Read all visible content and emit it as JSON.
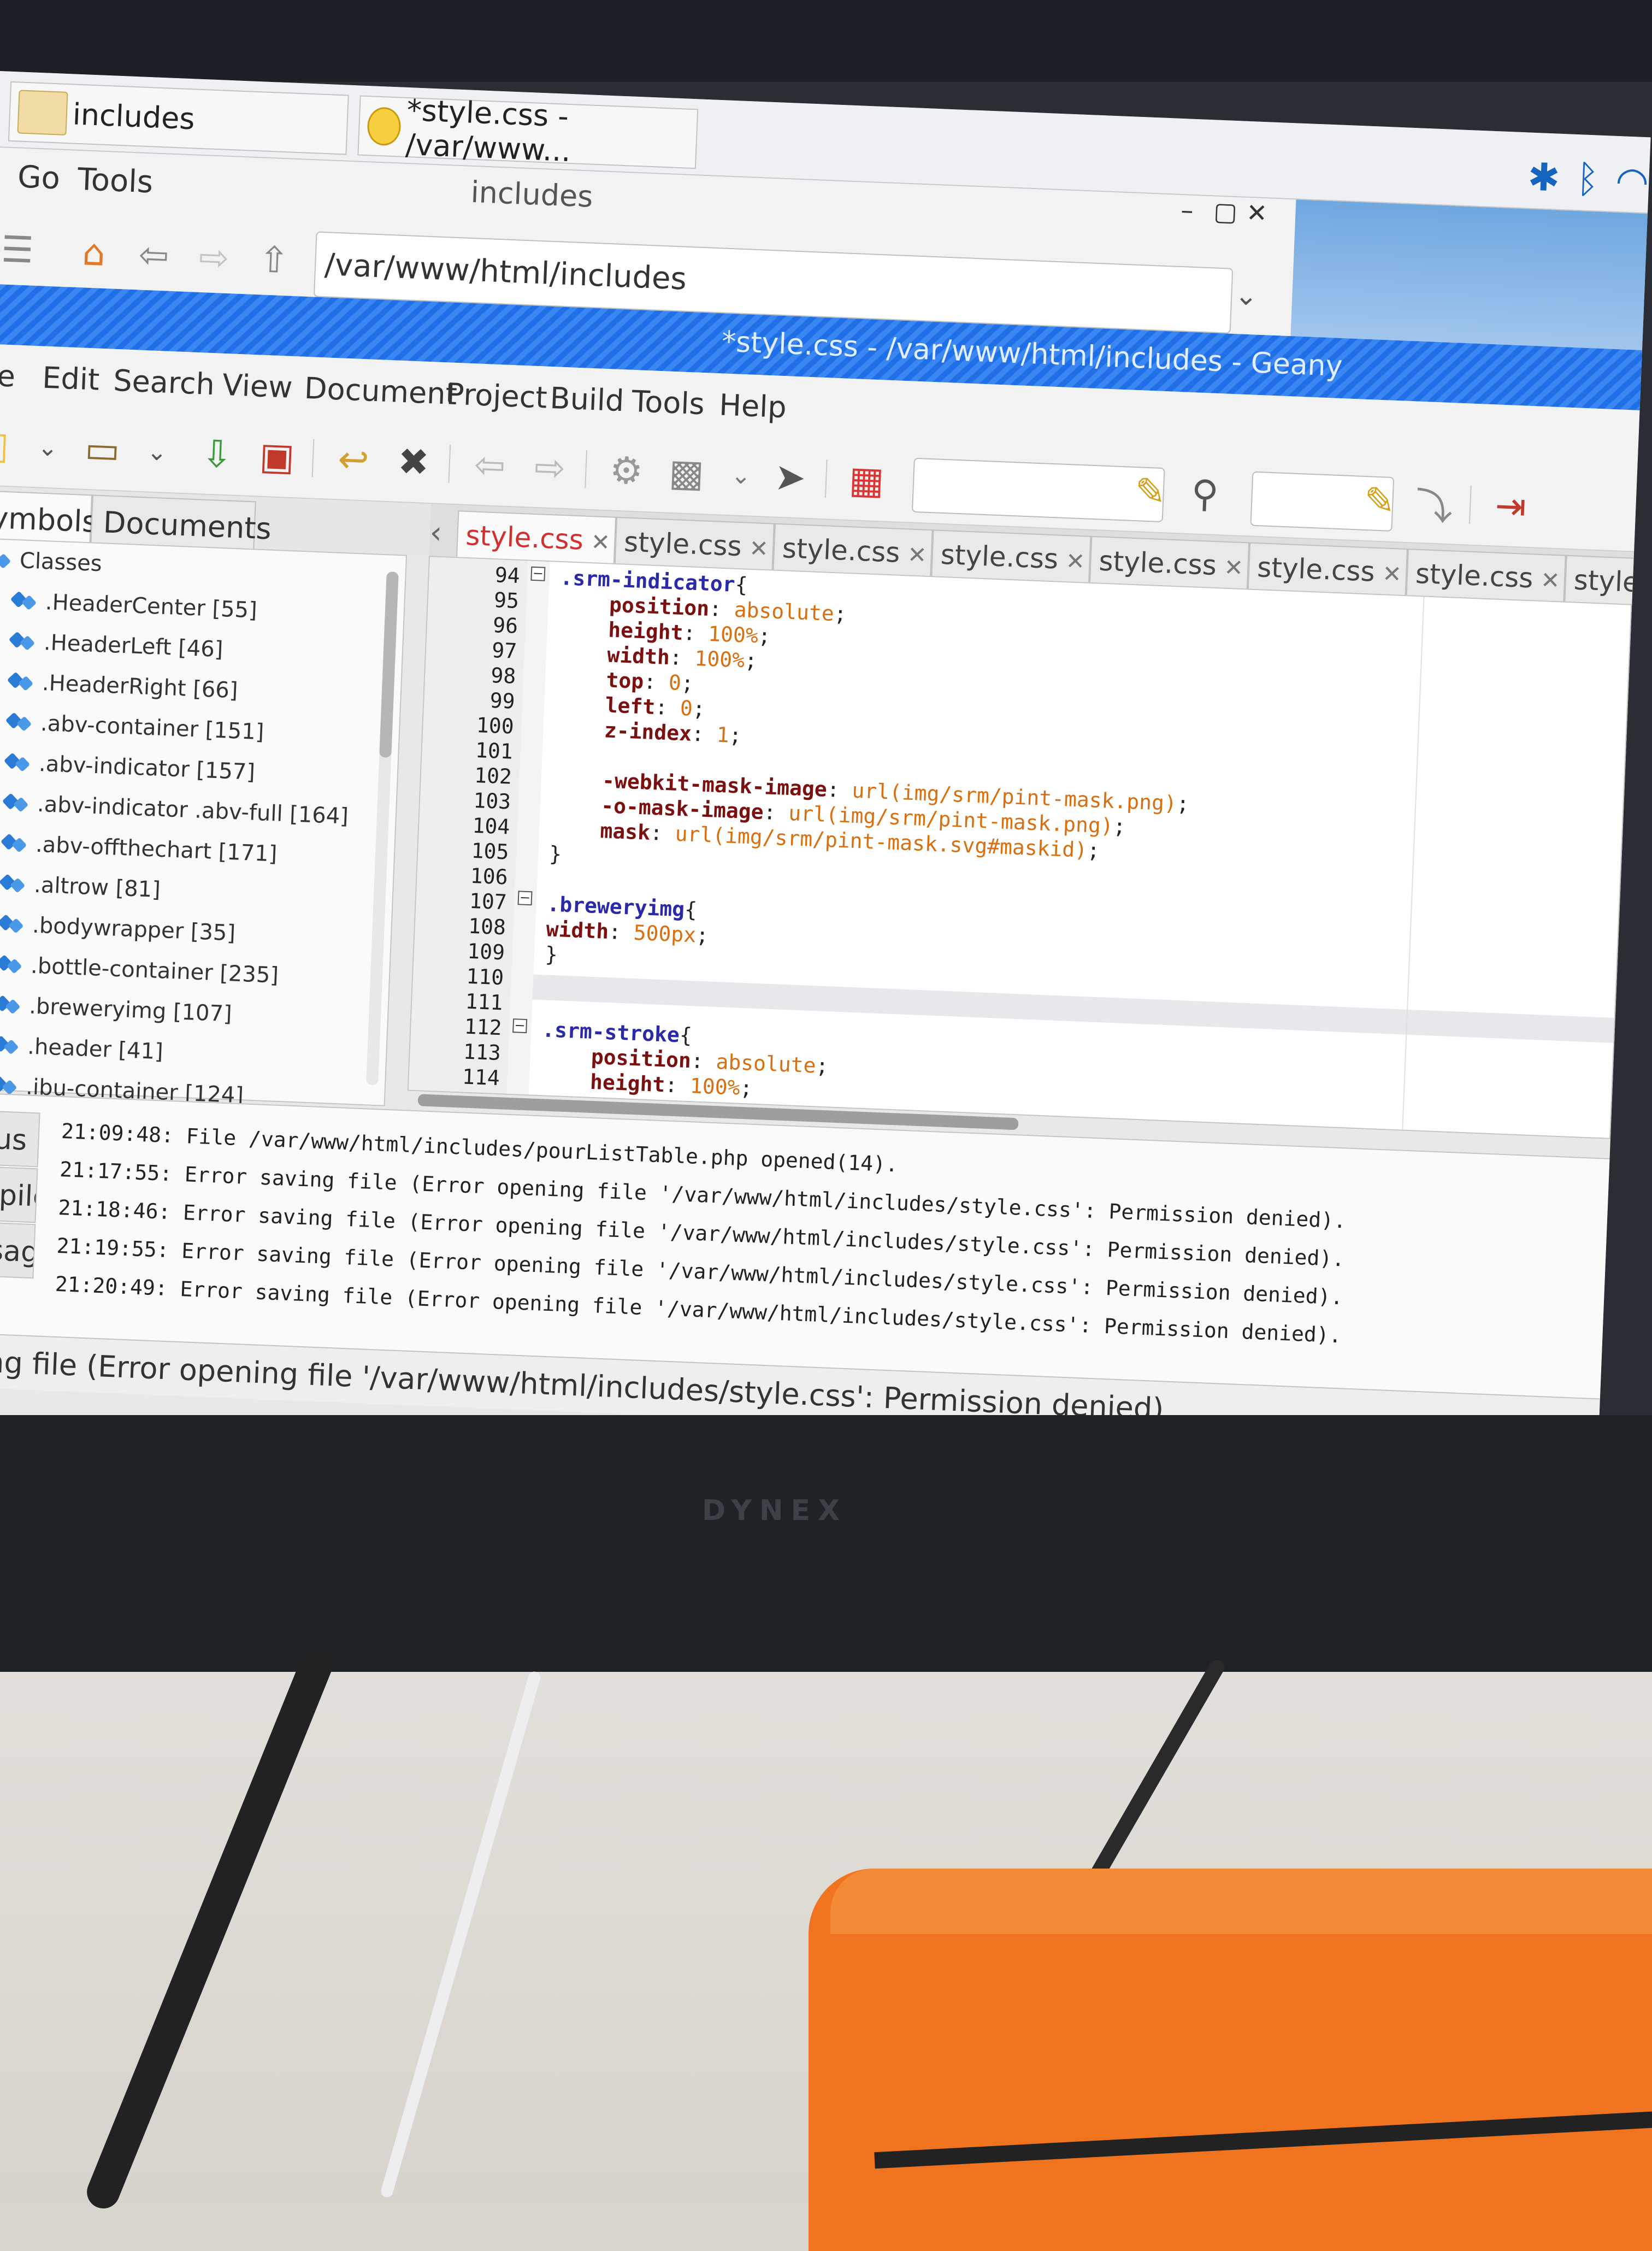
{
  "monitor": {
    "brand": "DYNEX"
  },
  "taskbar": {
    "buttons": [
      {
        "label": "includes",
        "icon": "folder-icon"
      },
      {
        "label": "*style.css - /var/www...",
        "icon": "geany-icon"
      }
    ],
    "tray_icons": [
      "bluetooth-icon",
      "bluetooth-icon",
      "wifi-icon"
    ]
  },
  "file_manager": {
    "title": "includes",
    "menu": [
      "Go",
      "Tools"
    ],
    "path": "/var/www/html/includes",
    "window_controls": [
      "–",
      "▢",
      "✕"
    ]
  },
  "geany": {
    "title": "*style.css - /var/www/html/includes - Geany",
    "menu": [
      "File",
      "Edit",
      "Search",
      "View",
      "Document",
      "Project",
      "Build",
      "Tools",
      "Help"
    ],
    "sidebar": {
      "tabs": [
        "Symbols",
        "Documents"
      ],
      "group": "Classes",
      "items": [
        ".HeaderCenter [55]",
        ".HeaderLeft [46]",
        ".HeaderRight [66]",
        ".abv-container [151]",
        ".abv-indicator [157]",
        ".abv-indicator .abv-full [164]",
        ".abv-offthechart [171]",
        ".altrow [81]",
        ".bodywrapper [35]",
        ".bottle-container [235]",
        ".breweryimg [107]",
        ".header [41]",
        ".ibu-container [124]"
      ]
    },
    "editor_tabs": [
      "style.css",
      "style.css",
      "style.css",
      "style.css",
      "style.css",
      "style.css",
      "style.css",
      "style"
    ],
    "line_numbers": [
      "94",
      "95",
      "96",
      "97",
      "98",
      "99",
      "100",
      "101",
      "102",
      "103",
      "104",
      "105",
      "106",
      "107",
      "108",
      "109",
      "110",
      "111",
      "112",
      "113",
      "114"
    ],
    "code": [
      [
        [
          "sel",
          ".srm-indicator"
        ],
        [
          "pun",
          "{"
        ]
      ],
      [
        [
          "sp",
          "    "
        ],
        [
          "prop",
          "position"
        ],
        [
          "pun",
          ": "
        ],
        [
          "val",
          "absolute"
        ],
        [
          "pun",
          ";"
        ]
      ],
      [
        [
          "sp",
          "    "
        ],
        [
          "prop",
          "height"
        ],
        [
          "pun",
          ": "
        ],
        [
          "val",
          "100%"
        ],
        [
          "pun",
          ";"
        ]
      ],
      [
        [
          "sp",
          "    "
        ],
        [
          "prop",
          "width"
        ],
        [
          "pun",
          ": "
        ],
        [
          "val",
          "100%"
        ],
        [
          "pun",
          ";"
        ]
      ],
      [
        [
          "sp",
          "    "
        ],
        [
          "prop",
          "top"
        ],
        [
          "pun",
          ": "
        ],
        [
          "val",
          "0"
        ],
        [
          "pun",
          ";"
        ]
      ],
      [
        [
          "sp",
          "    "
        ],
        [
          "prop",
          "left"
        ],
        [
          "pun",
          ": "
        ],
        [
          "val",
          "0"
        ],
        [
          "pun",
          ";"
        ]
      ],
      [
        [
          "sp",
          "    "
        ],
        [
          "prop",
          "z-index"
        ],
        [
          "pun",
          ": "
        ],
        [
          "val",
          "1"
        ],
        [
          "pun",
          ";"
        ]
      ],
      [],
      [
        [
          "sp",
          "    "
        ],
        [
          "prop",
          "-webkit-mask-image"
        ],
        [
          "pun",
          ": "
        ],
        [
          "val",
          "url(img/srm/pint-mask.png)"
        ],
        [
          "pun",
          ";"
        ]
      ],
      [
        [
          "sp",
          "    "
        ],
        [
          "prop",
          "-o-mask-image"
        ],
        [
          "pun",
          ": "
        ],
        [
          "val",
          "url(img/srm/pint-mask.png)"
        ],
        [
          "pun",
          ";"
        ]
      ],
      [
        [
          "sp",
          "    "
        ],
        [
          "prop",
          "mask"
        ],
        [
          "pun",
          ": "
        ],
        [
          "val",
          "url(img/srm/pint-mask.svg#maskid)"
        ],
        [
          "pun",
          ";"
        ]
      ],
      [
        [
          "pun",
          "}"
        ]
      ],
      [],
      [
        [
          "sel",
          ".breweryimg"
        ],
        [
          "pun",
          "{"
        ]
      ],
      [
        [
          "prop",
          "width"
        ],
        [
          "pun",
          ": "
        ],
        [
          "val",
          "500px"
        ],
        [
          "pun",
          ";"
        ]
      ],
      [
        [
          "pun",
          "}"
        ]
      ],
      [],
      [],
      [
        [
          "sel",
          ".srm-stroke"
        ],
        [
          "pun",
          "{"
        ]
      ],
      [
        [
          "sp",
          "    "
        ],
        [
          "prop",
          "position"
        ],
        [
          "pun",
          ": "
        ],
        [
          "val",
          "absolute"
        ],
        [
          "pun",
          ";"
        ]
      ],
      [
        [
          "sp",
          "    "
        ],
        [
          "prop",
          "height"
        ],
        [
          "pun",
          ": "
        ],
        [
          "val",
          "100%"
        ],
        [
          "pun",
          ";"
        ]
      ]
    ],
    "message_tabs": [
      "Status",
      "Compiler",
      "Messages"
    ],
    "messages": [
      "21:09:48: File /var/www/html/includes/pourListTable.php opened(14).",
      "21:17:55: Error saving file (Error opening file '/var/www/html/includes/style.css': Permission denied).",
      "21:18:46: Error saving file (Error opening file '/var/www/html/includes/style.css': Permission denied).",
      "21:19:55: Error saving file (Error opening file '/var/www/html/includes/style.css': Permission denied).",
      "21:20:49: Error saving file (Error opening file '/var/www/html/includes/style.css': Permission denied)."
    ],
    "statusbar": "saving file (Error opening file '/var/www/html/includes/style.css': Permission denied)."
  }
}
